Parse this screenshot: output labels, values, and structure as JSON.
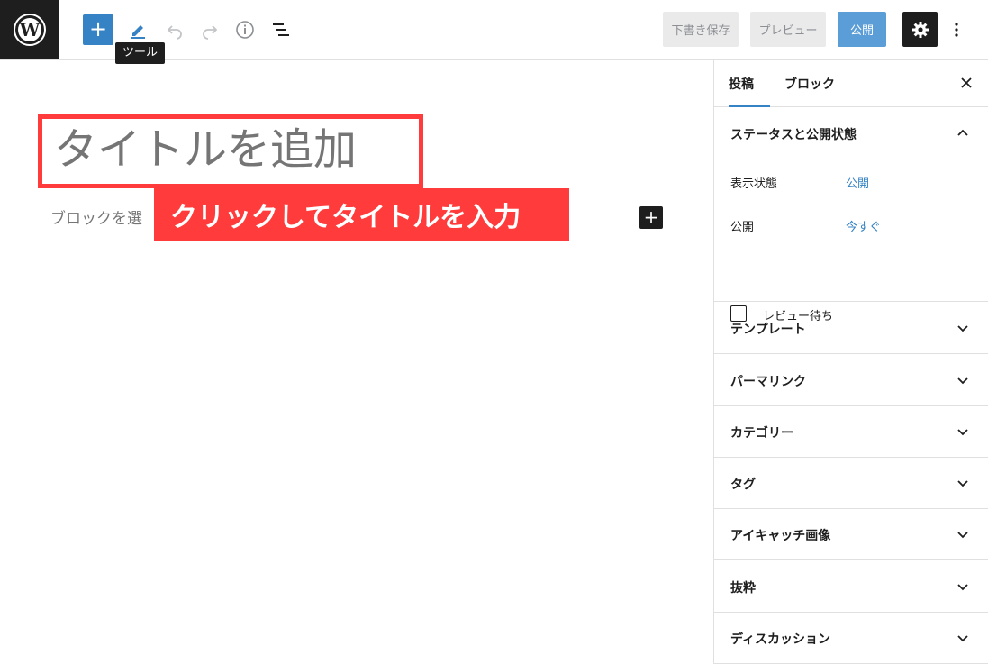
{
  "toolbar": {
    "add_label": "+",
    "tooltip": "ツール",
    "save_draft": "下書き保存",
    "preview": "プレビュー",
    "publish": "公開"
  },
  "editor": {
    "title_placeholder": "タイトルを追加",
    "block_placeholder": "ブロックを選",
    "annotation": "クリックしてタイトルを入力",
    "block_add": "+"
  },
  "sidebar": {
    "tabs": [
      "投稿",
      "ブロック"
    ],
    "status_panel": {
      "title": "ステータスと公開状態",
      "visibility_label": "表示状態",
      "visibility_value": "公開",
      "publish_label": "公開",
      "publish_value": "今すぐ",
      "pending_review": "レビュー待ち"
    },
    "panels": [
      "テンプレート",
      "パーマリンク",
      "カテゴリー",
      "タグ",
      "アイキャッチ画像",
      "抜粋",
      "ディスカッション"
    ]
  },
  "colors": {
    "accent": "#3582c4",
    "annotation": "#ff3b3b",
    "dark": "#1e1e1e"
  }
}
